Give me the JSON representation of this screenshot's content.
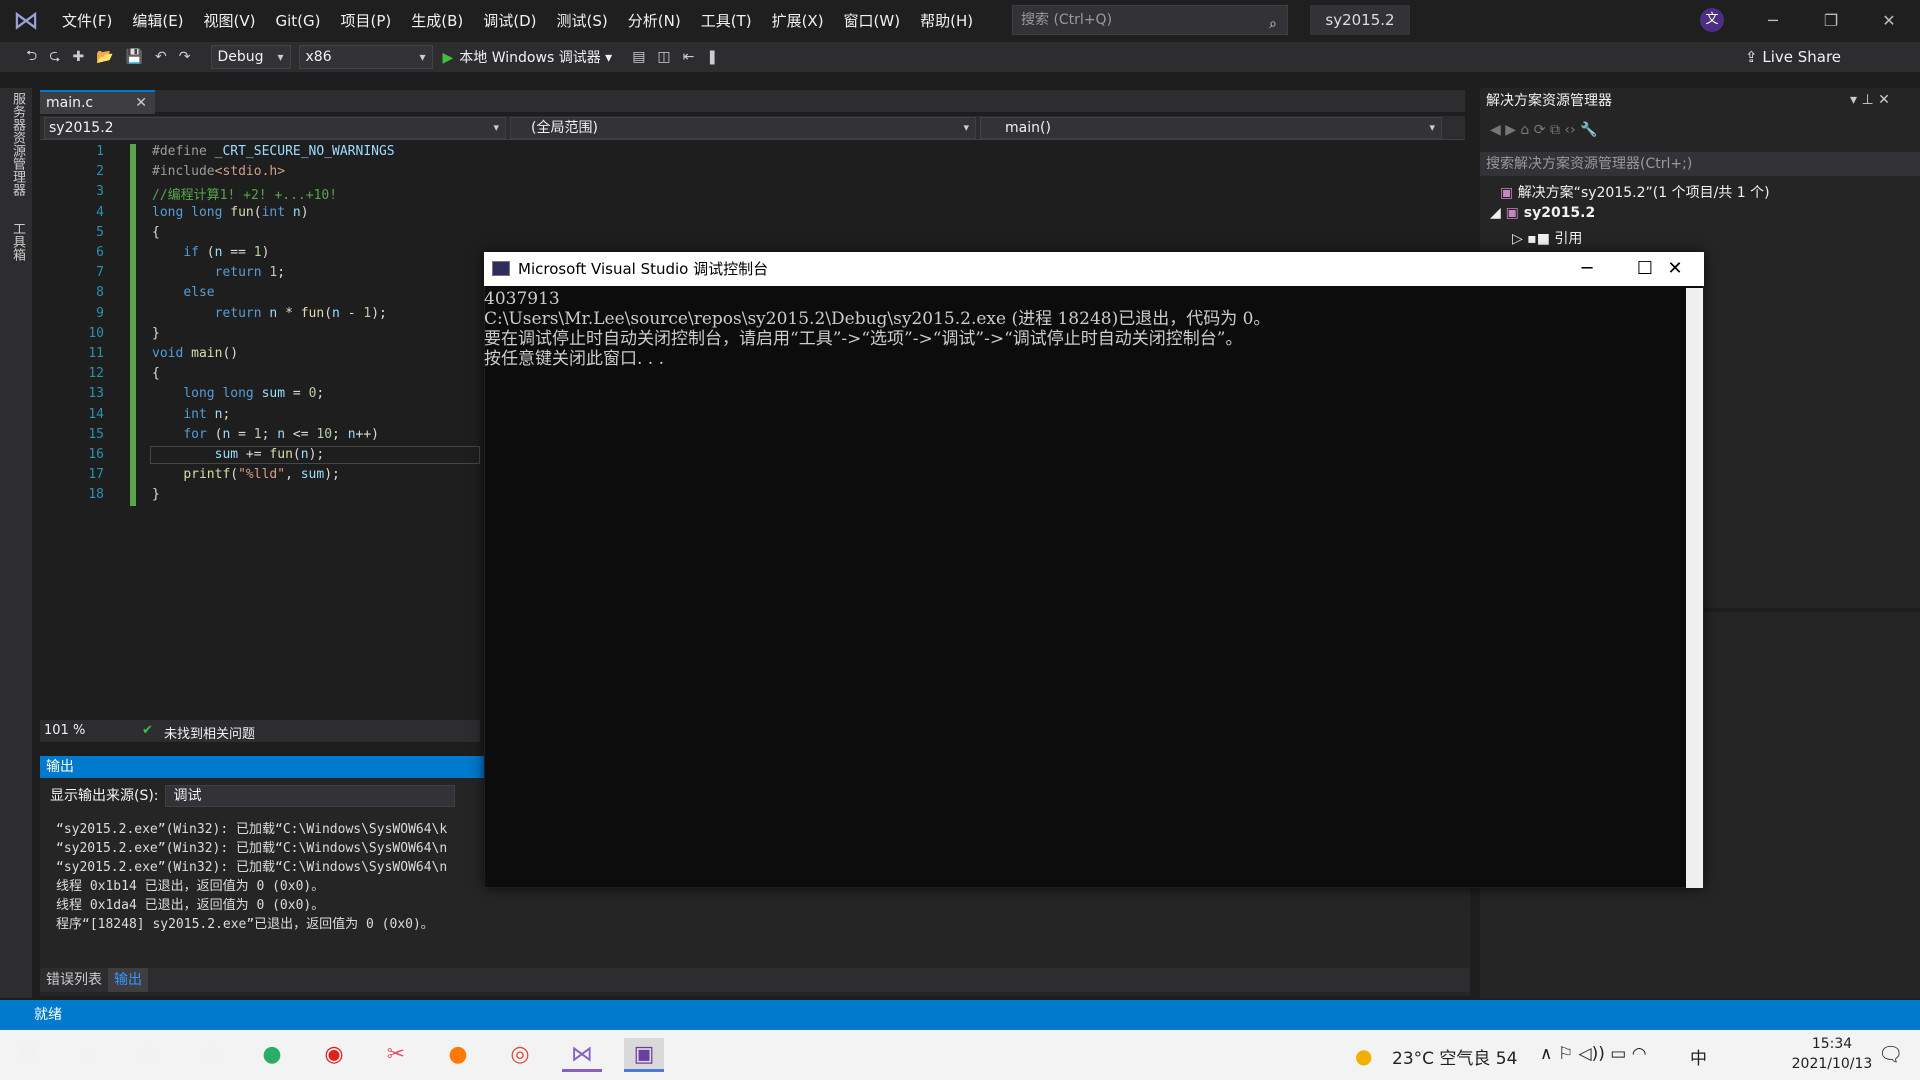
{
  "menu": [
    "文件(F)",
    "编辑(E)",
    "视图(V)",
    "Git(G)",
    "项目(P)",
    "生成(B)",
    "调试(D)",
    "测试(S)",
    "分析(N)",
    "工具(T)",
    "扩展(X)",
    "窗口(W)",
    "帮助(H)"
  ],
  "search": {
    "placeholder": "搜索 (Ctrl+Q)"
  },
  "title": {
    "project": "sy2015.2",
    "avatar": "文"
  },
  "toolbar": {
    "config": "Debug",
    "platform": "x86",
    "run": "本地 Windows 调试器",
    "live_share": "Live Share"
  },
  "left_tabs": [
    "服务器资源管理器",
    "工具箱"
  ],
  "editor": {
    "tab": "main.c",
    "nav_project": "sy2015.2",
    "nav_scope": "(全局范围)",
    "nav_func": "main()",
    "zoom": "101 %",
    "issues": "未找到相关问题",
    "lines": [
      {
        "n": "1",
        "segs": [
          {
            "c": "pp",
            "t": "#define "
          },
          {
            "c": "var",
            "t": "_CRT_SECURE_NO_WARNINGS"
          }
        ]
      },
      {
        "n": "2",
        "segs": [
          {
            "c": "pp",
            "t": "#include"
          },
          {
            "c": "str",
            "t": "<stdio.h>"
          }
        ]
      },
      {
        "n": "3",
        "segs": [
          {
            "c": "cm",
            "t": "//编程计算1! +2! +...+10!"
          }
        ]
      },
      {
        "n": "4",
        "segs": [
          {
            "c": "kw",
            "t": "long long "
          },
          {
            "c": "fn",
            "t": "fun"
          },
          {
            "c": "",
            "t": "("
          },
          {
            "c": "kw",
            "t": "int "
          },
          {
            "c": "var",
            "t": "n"
          },
          {
            "c": "",
            "t": ")"
          }
        ]
      },
      {
        "n": "5",
        "segs": [
          {
            "c": "",
            "t": "{"
          }
        ]
      },
      {
        "n": "6",
        "segs": [
          {
            "c": "",
            "t": "    "
          },
          {
            "c": "kw",
            "t": "if "
          },
          {
            "c": "",
            "t": "("
          },
          {
            "c": "var",
            "t": "n"
          },
          {
            "c": "",
            "t": " == "
          },
          {
            "c": "num",
            "t": "1"
          },
          {
            "c": "",
            "t": ")"
          }
        ]
      },
      {
        "n": "7",
        "segs": [
          {
            "c": "",
            "t": "        "
          },
          {
            "c": "kw",
            "t": "return "
          },
          {
            "c": "num",
            "t": "1"
          },
          {
            "c": "",
            "t": ";"
          }
        ]
      },
      {
        "n": "8",
        "segs": [
          {
            "c": "",
            "t": "    "
          },
          {
            "c": "kw",
            "t": "else"
          }
        ]
      },
      {
        "n": "9",
        "segs": [
          {
            "c": "",
            "t": "        "
          },
          {
            "c": "kw",
            "t": "return "
          },
          {
            "c": "var",
            "t": "n"
          },
          {
            "c": "",
            "t": " * "
          },
          {
            "c": "fn",
            "t": "fun"
          },
          {
            "c": "",
            "t": "("
          },
          {
            "c": "var",
            "t": "n"
          },
          {
            "c": "",
            "t": " - "
          },
          {
            "c": "num",
            "t": "1"
          },
          {
            "c": "",
            "t": ");"
          }
        ]
      },
      {
        "n": "10",
        "segs": [
          {
            "c": "",
            "t": "}"
          }
        ]
      },
      {
        "n": "11",
        "segs": [
          {
            "c": "kw",
            "t": "void "
          },
          {
            "c": "fn",
            "t": "main"
          },
          {
            "c": "",
            "t": "()"
          }
        ]
      },
      {
        "n": "12",
        "segs": [
          {
            "c": "",
            "t": "{"
          }
        ]
      },
      {
        "n": "13",
        "segs": [
          {
            "c": "",
            "t": "    "
          },
          {
            "c": "kw",
            "t": "long long "
          },
          {
            "c": "var",
            "t": "sum"
          },
          {
            "c": "",
            "t": " = "
          },
          {
            "c": "num",
            "t": "0"
          },
          {
            "c": "",
            "t": ";"
          }
        ]
      },
      {
        "n": "14",
        "segs": [
          {
            "c": "",
            "t": "    "
          },
          {
            "c": "kw",
            "t": "int "
          },
          {
            "c": "var",
            "t": "n"
          },
          {
            "c": "",
            "t": ";"
          }
        ]
      },
      {
        "n": "15",
        "segs": [
          {
            "c": "",
            "t": "    "
          },
          {
            "c": "kw",
            "t": "for "
          },
          {
            "c": "",
            "t": "("
          },
          {
            "c": "var",
            "t": "n"
          },
          {
            "c": "",
            "t": " = "
          },
          {
            "c": "num",
            "t": "1"
          },
          {
            "c": "",
            "t": "; "
          },
          {
            "c": "var",
            "t": "n"
          },
          {
            "c": "",
            "t": " <= "
          },
          {
            "c": "num",
            "t": "10"
          },
          {
            "c": "",
            "t": "; "
          },
          {
            "c": "var",
            "t": "n"
          },
          {
            "c": "",
            "t": "++)"
          }
        ]
      },
      {
        "n": "16",
        "segs": [
          {
            "c": "",
            "t": "        "
          },
          {
            "c": "var",
            "t": "sum"
          },
          {
            "c": "",
            "t": " += "
          },
          {
            "c": "fn",
            "t": "fun"
          },
          {
            "c": "",
            "t": "("
          },
          {
            "c": "var",
            "t": "n"
          },
          {
            "c": "",
            "t": ");"
          }
        ]
      },
      {
        "n": "17",
        "segs": [
          {
            "c": "",
            "t": "    "
          },
          {
            "c": "fn",
            "t": "printf"
          },
          {
            "c": "",
            "t": "("
          },
          {
            "c": "str",
            "t": "\"%lld\""
          },
          {
            "c": "",
            "t": ", "
          },
          {
            "c": "var",
            "t": "sum"
          },
          {
            "c": "",
            "t": ");"
          }
        ]
      },
      {
        "n": "18",
        "segs": [
          {
            "c": "",
            "t": "}"
          }
        ]
      }
    ]
  },
  "output": {
    "title": "输出",
    "source_label": "显示输出来源(S):",
    "source_value": "调试",
    "lines": [
      "“sy2015.2.exe”(Win32): 已加载“C:\\Windows\\SysWOW64\\k",
      "“sy2015.2.exe”(Win32): 已加载“C:\\Windows\\SysWOW64\\n",
      "“sy2015.2.exe”(Win32): 已加载“C:\\Windows\\SysWOW64\\n",
      "线程 0x1b14 已退出，返回值为 0 (0x0)。",
      "线程 0x1da4 已退出，返回值为 0 (0x0)。",
      "程序“[18248] sy2015.2.exe”已退出，返回值为 0 (0x0)。"
    ],
    "tabs": [
      "错误列表",
      "输出"
    ]
  },
  "solution": {
    "title": "解决方案资源管理器",
    "search": "搜索解决方案资源管理器(Ctrl+;)",
    "root": "解决方案“sy2015.2”(1 个项目/共 1 个)",
    "project": "sy2015.2",
    "ref": "引用"
  },
  "console": {
    "title": "Microsoft Visual Studio 调试控制台",
    "lines": [
      "4037913",
      "C:\\Users\\Mr.Lee\\source\\repos\\sy2015.2\\Debug\\sy2015.2.exe (进程 18248)已退出，代码为 0。",
      "要在调试停止时自动关闭控制台，请启用“工具”->“选项”->“调试”->“调试停止时自动关闭控制台”。",
      "按任意键关闭此窗口. . ."
    ]
  },
  "status": {
    "text": "就绪"
  },
  "taskbar": {
    "weather": "23°C 空气良 54",
    "time": "15:34",
    "date": "2021/10/13",
    "ime": "中"
  }
}
